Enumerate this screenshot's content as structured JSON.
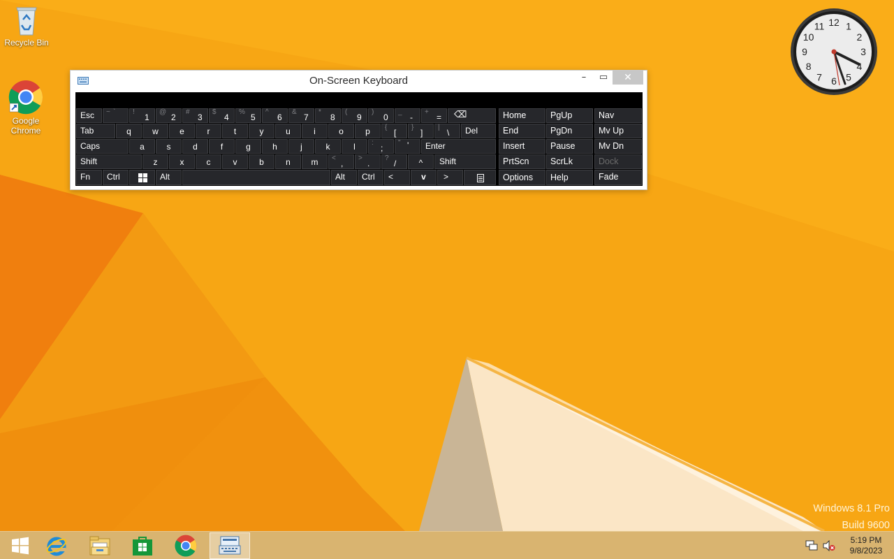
{
  "desktop": {
    "icons": [
      {
        "label": "Recycle Bin"
      },
      {
        "label": "Google Chrome"
      }
    ],
    "watermark": {
      "line1": "Windows 8.1 Pro",
      "line2": "Build 9600"
    }
  },
  "clock_gadget": {
    "numbers": [
      "12",
      "1",
      "2",
      "3",
      "4",
      "5",
      "6",
      "7",
      "8",
      "9",
      "10",
      "11"
    ],
    "time": "5:19"
  },
  "osk": {
    "title": "On-Screen Keyboard",
    "minimize_glyph": "–",
    "maximize_glyph": "▭",
    "close_glyph": "✕",
    "keys": {
      "esc": "Esc",
      "tilde": {
        "sec": "~",
        "pri": "`"
      },
      "n1": {
        "sec": "!",
        "pri": "1"
      },
      "n2": {
        "sec": "@",
        "pri": "2"
      },
      "n3": {
        "sec": "#",
        "pri": "3"
      },
      "n4": {
        "sec": "$",
        "pri": "4"
      },
      "n5": {
        "sec": "%",
        "pri": "5"
      },
      "n6": {
        "sec": "^",
        "pri": "6"
      },
      "n7": {
        "sec": "&",
        "pri": "7"
      },
      "n8": {
        "sec": "*",
        "pri": "8"
      },
      "n9": {
        "sec": "(",
        "pri": "9"
      },
      "n0": {
        "sec": ")",
        "pri": "0"
      },
      "minus": {
        "sec": "_",
        "pri": "-"
      },
      "equal": {
        "sec": "+",
        "pri": "="
      },
      "backspace": "⌫",
      "tab": "Tab",
      "q": "q",
      "w": "w",
      "e": "e",
      "r": "r",
      "t": "t",
      "y": "y",
      "u": "u",
      "i": "i",
      "o": "o",
      "p": "p",
      "lbracket": {
        "sec": "{",
        "pri": "["
      },
      "rbracket": {
        "sec": "}",
        "pri": "]"
      },
      "backslash": {
        "sec": "|",
        "pri": "\\"
      },
      "del": "Del",
      "caps": "Caps",
      "a": "a",
      "s": "s",
      "d": "d",
      "f": "f",
      "g": "g",
      "h": "h",
      "j": "j",
      "k": "k",
      "l": "l",
      "semicolon": {
        "sec": ":",
        "pri": ";"
      },
      "quote": {
        "sec": "\"",
        "pri": "'"
      },
      "enter": "Enter",
      "shift_l": "Shift",
      "z": "z",
      "x": "x",
      "c": "c",
      "v": "v",
      "b": "b",
      "n": "n",
      "m": "m",
      "comma": {
        "sec": "<",
        "pri": ","
      },
      "period": {
        "sec": ">",
        "pri": "."
      },
      "slash": {
        "sec": "?",
        "pri": "/"
      },
      "up": "^",
      "shift_r": "Shift",
      "fn": "Fn",
      "ctrl_l": "Ctrl",
      "alt_l": "Alt",
      "alt_r": "Alt",
      "ctrl_r": "Ctrl",
      "left": "<",
      "down": "v",
      "right": ">",
      "home": "Home",
      "pgup": "PgUp",
      "nav": "Nav",
      "end": "End",
      "pgdn": "PgDn",
      "mvup": "Mv Up",
      "insert": "Insert",
      "pause": "Pause",
      "mvdn": "Mv Dn",
      "prtscn": "PrtScn",
      "scrlk": "ScrLk",
      "dock": "Dock",
      "options": "Options",
      "help": "Help",
      "fade": "Fade"
    }
  },
  "taskbar": {
    "apps": [
      {
        "icon": "start-windows-icon"
      },
      {
        "icon": "internet-explorer-icon"
      },
      {
        "icon": "file-explorer-icon"
      },
      {
        "icon": "store-icon"
      },
      {
        "icon": "chrome-icon"
      },
      {
        "icon": "on-screen-keyboard-icon",
        "active": true
      }
    ],
    "time": "5:19 PM",
    "date": "9/8/2023"
  }
}
